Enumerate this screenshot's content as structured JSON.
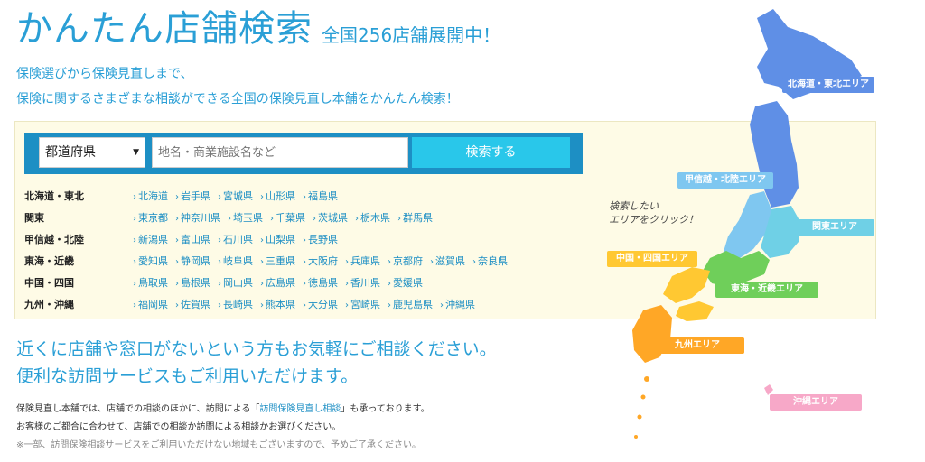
{
  "header": {
    "title": "かんたん店舗検索",
    "subtitle": "全国256店舗展開中！"
  },
  "lead": {
    "line1": "保険選びから保険見直しまで、",
    "line2": "保険に関するさまざまな相談ができる全国の保険見直し本舗をかんたん検索！"
  },
  "search": {
    "select_value": "都道府県",
    "placeholder": "地名・商業施設名など",
    "button_label": "検索する"
  },
  "regions": [
    {
      "name": "北海道・東北",
      "prefs": [
        "北海道",
        "岩手県",
        "宮城県",
        "山形県",
        "福島県"
      ]
    },
    {
      "name": "関東",
      "prefs": [
        "東京都",
        "神奈川県",
        "埼玉県",
        "千葉県",
        "茨城県",
        "栃木県",
        "群馬県"
      ]
    },
    {
      "name": "甲信越・北陸",
      "prefs": [
        "新潟県",
        "富山県",
        "石川県",
        "山梨県",
        "長野県"
      ]
    },
    {
      "name": "東海・近畿",
      "prefs": [
        "愛知県",
        "静岡県",
        "岐阜県",
        "三重県",
        "大阪府",
        "兵庫県",
        "京都府",
        "滋賀県",
        "奈良県"
      ]
    },
    {
      "name": "中国・四国",
      "prefs": [
        "鳥取県",
        "島根県",
        "岡山県",
        "広島県",
        "徳島県",
        "香川県",
        "愛媛県"
      ]
    },
    {
      "name": "九州・沖縄",
      "prefs": [
        "福岡県",
        "佐賀県",
        "長崎県",
        "熊本県",
        "大分県",
        "宮崎県",
        "鹿児島県",
        "沖縄県"
      ]
    }
  ],
  "visit": {
    "line1": "近くに店舗や窓口がないという方もお気軽にご相談ください。",
    "line2": "便利な訪問サービスもご利用いただけます。"
  },
  "notes": {
    "line1_pre": "保険見直し本舗では、店舗での相談のほかに、訪問による「",
    "line1_link": "訪問保険見直し相談",
    "line1_post": "」も承っております。",
    "line2": "お客様のご都合に合わせて、店舗での相談か訪問による相談かお選びください。",
    "line3": "※一部、訪問保険相談サービスをご利用いただけない地域もございますので、予めご了承ください。"
  },
  "map": {
    "hint_line1": "検索したい",
    "hint_line2": "エリアをクリック！",
    "areas": {
      "hokkaido_tohoku": "北海道・東北エリア",
      "koshinetsu_hokuriku": "甲信越・北陸エリア",
      "kanto": "関東エリア",
      "chugoku_shikoku": "中国・四国エリア",
      "tokai_kinki": "東海・近畿エリア",
      "kyushu": "九州エリア",
      "okinawa": "沖縄エリア"
    },
    "colors": {
      "hokkaido_tohoku": "#5f8fe6",
      "koshinetsu_hokuriku": "#7fc7f0",
      "kanto": "#6fd0e6",
      "chugoku_shikoku": "#ffc832",
      "tokai_kinki": "#6fcf5a",
      "kyushu": "#ffa726",
      "okinawa": "#f7a8c8"
    }
  }
}
